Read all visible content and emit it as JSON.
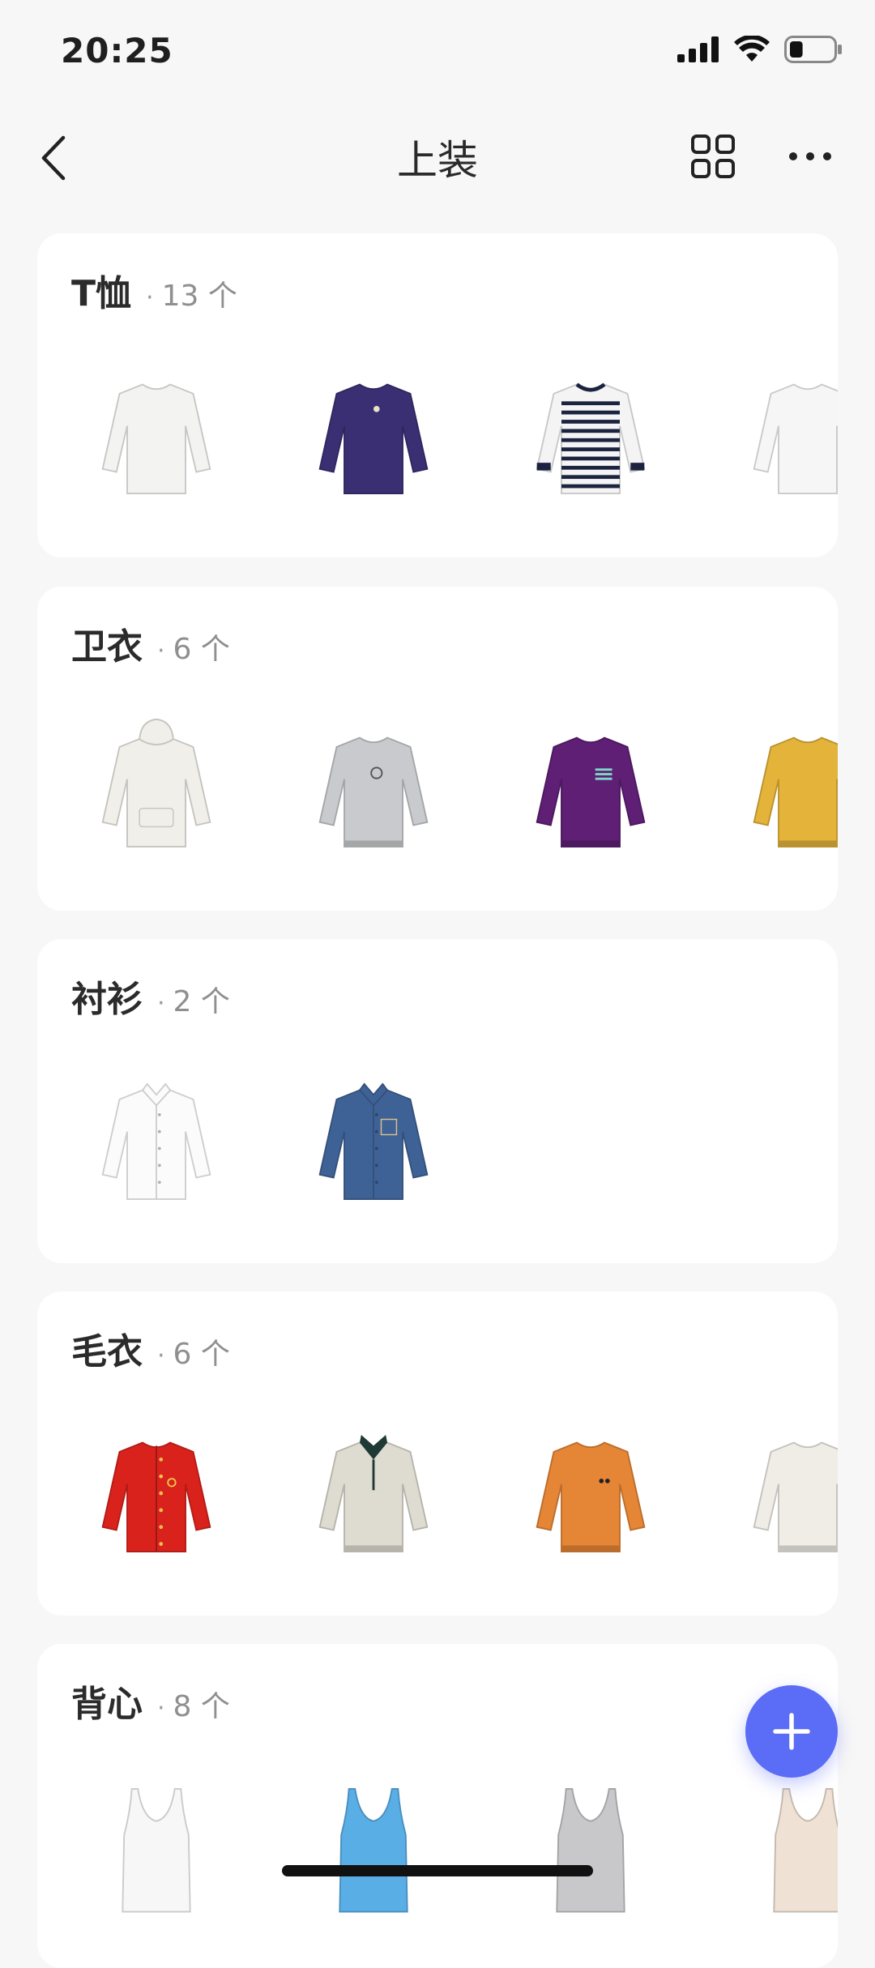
{
  "status_bar": {
    "time": "20:25",
    "battery_level": 0.3
  },
  "nav": {
    "title": "上装"
  },
  "accent_color": "#5b6cf6",
  "categories": [
    {
      "name": "T恤",
      "dot": "·",
      "count": "13 个",
      "items": [
        {
          "icon": "white-long-sleeve-tee",
          "color": "#f3f3f1"
        },
        {
          "icon": "navy-long-sleeve-tee",
          "color": "#3a2f73"
        },
        {
          "icon": "striped-long-sleeve-tee",
          "color": "#f4f4f4"
        },
        {
          "icon": "white-long-sleeve-tee",
          "color": "#f6f6f6"
        }
      ]
    },
    {
      "name": "卫衣",
      "dot": "·",
      "count": "6 个",
      "items": [
        {
          "icon": "white-hoodie",
          "color": "#f1efe9"
        },
        {
          "icon": "grey-sweatshirt",
          "color": "#c9cacd"
        },
        {
          "icon": "purple-sweatshirt",
          "color": "#5e1f74"
        },
        {
          "icon": "yellow-sweatshirt",
          "color": "#e3b33a"
        }
      ]
    },
    {
      "name": "衬衫",
      "dot": "·",
      "count": "2 个",
      "items": [
        {
          "icon": "white-shirt",
          "color": "#fbfbfb"
        },
        {
          "icon": "denim-shirt",
          "color": "#3f6296"
        }
      ]
    },
    {
      "name": "毛衣",
      "dot": "·",
      "count": "6 个",
      "items": [
        {
          "icon": "red-cardigan",
          "color": "#d9221c"
        },
        {
          "icon": "beige-polo-sweater",
          "color": "#dedbd0"
        },
        {
          "icon": "orange-sweater",
          "color": "#e58536"
        },
        {
          "icon": "cream-sweater",
          "color": "#efede6"
        }
      ]
    },
    {
      "name": "背心",
      "dot": "·",
      "count": "8 个",
      "items": [
        {
          "icon": "white-tank-top",
          "color": "#f7f7f7"
        },
        {
          "icon": "blue-tank-top",
          "color": "#5aaee6"
        },
        {
          "icon": "grey-tank-top",
          "color": "#c8c8cb"
        },
        {
          "icon": "beige-camisole",
          "color": "#efe2d4"
        }
      ]
    }
  ]
}
